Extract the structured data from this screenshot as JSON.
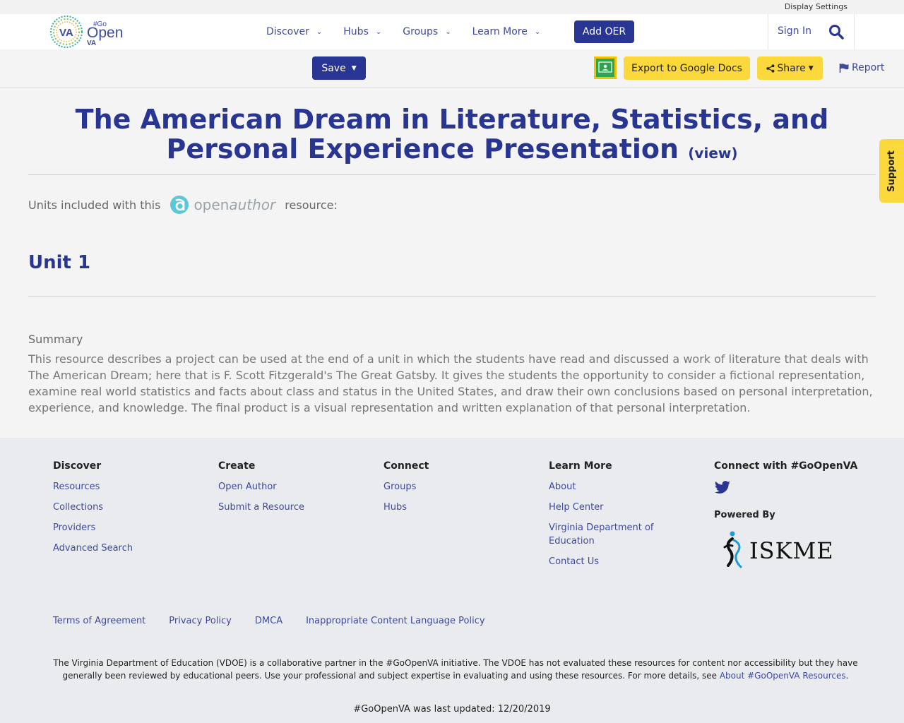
{
  "utility": {
    "display_settings": "Display Settings"
  },
  "header": {
    "logo": {
      "state": "VA",
      "go": "#Go",
      "open": "Open",
      "va": "VA"
    },
    "nav": [
      {
        "label": "Discover"
      },
      {
        "label": "Hubs"
      },
      {
        "label": "Groups"
      },
      {
        "label": "Learn More"
      }
    ],
    "add_oer": "Add OER",
    "sign_in": "Sign In"
  },
  "actions": {
    "save": "Save",
    "export": "Export to Google Docs",
    "share": "Share",
    "report": "Report"
  },
  "main": {
    "title": "The American Dream in Literature, Statistics, and Personal Experience Presentation",
    "view_link": "(view)",
    "units_prefix": "Units included with this",
    "units_suffix": "resource:",
    "openauthor_open": "open",
    "openauthor_author": "author",
    "unit_title": "Unit 1",
    "summary_label": "Summary",
    "summary_text": "This resource describes a project can be used at the end of a unit in which the students have read and discussed a work of literature that deals with The American Dream; here that is F. Scott Fitzgerald's The Great Gatsby. It gives the students the opportunity to consider a fictional representation, examine real world statistics and facts about class and status in the United States, and draw their own conclusions based on personal interpretation, experience, and knowledge. The final product is a visual representation and written explanation of that personal interpretation."
  },
  "support": "Support",
  "footer": {
    "columns": [
      {
        "heading": "Discover",
        "links": [
          "Resources",
          "Collections",
          "Providers",
          "Advanced Search"
        ]
      },
      {
        "heading": "Create",
        "links": [
          "Open Author",
          "Submit a Resource"
        ]
      },
      {
        "heading": "Connect",
        "links": [
          "Groups",
          "Hubs"
        ]
      },
      {
        "heading": "Learn More",
        "links": [
          "About",
          "Help Center",
          "Virginia Department of Education",
          "Contact Us"
        ]
      }
    ],
    "connect_heading": "Connect with #GoOpenVA",
    "powered_by": "Powered By",
    "iskme": "ISKME",
    "legal": [
      "Terms of Agreement",
      "Privacy Policy",
      "DMCA",
      "Inappropriate Content Language Policy"
    ],
    "disclaimer": "The Virginia Department of Education (VDOE) is a collaborative partner in the #GoOpenVA initiative. The VDOE has not evaluated these resources for content nor accessibility but they have generally been reviewed by educational peers. Use your professional and subject expertise in evaluating and using these resources. For more details, see ",
    "disclaimer_link": "About #GoOpenVA Resources",
    "disclaimer_end": ".",
    "updated": "#GoOpenVA was last updated: 12/20/2019"
  },
  "colors": {
    "brand_blue": "#283593",
    "link_blue": "#3e4a9e",
    "accent_yellow": "#fbd83c"
  }
}
